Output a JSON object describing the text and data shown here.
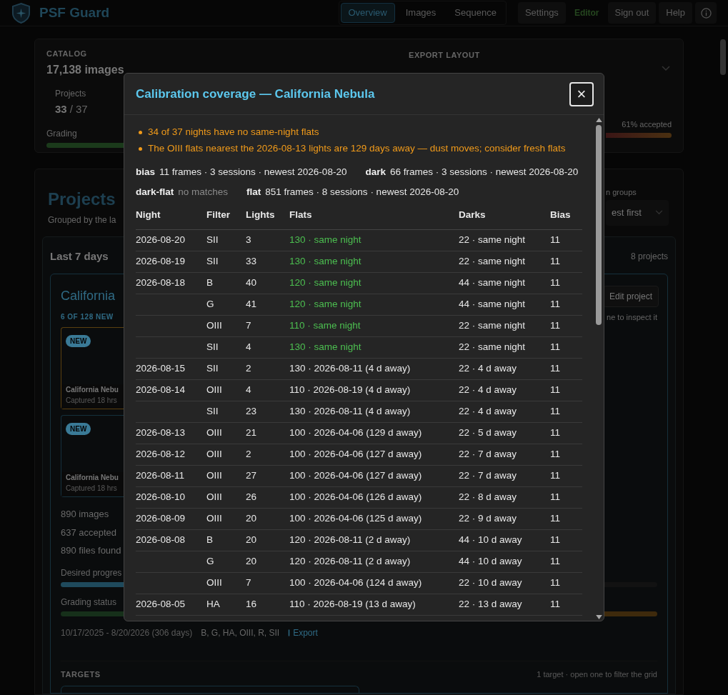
{
  "app": {
    "name": "PSF Guard"
  },
  "nav": {
    "tabs": [
      {
        "label": "Overview",
        "selected": true
      },
      {
        "label": "Images",
        "selected": false
      },
      {
        "label": "Sequence",
        "selected": false
      }
    ],
    "buttons": [
      {
        "kind": "button",
        "label": "Settings"
      },
      {
        "kind": "role",
        "label": "Editor"
      },
      {
        "kind": "button",
        "label": "Sign out"
      },
      {
        "kind": "button",
        "label": "Help"
      },
      {
        "kind": "info"
      }
    ]
  },
  "catalog": {
    "heading": "CATALOG",
    "count": "17,138 images",
    "stat_label": "Projects",
    "stat_value": "33",
    "stat_total": "/ 37",
    "grading_label": "Grading",
    "export_layout_label": "EXPORT LAYOUT",
    "accepted": "61% accepted"
  },
  "projects": {
    "title": "Projects",
    "subtitle": "Grouped by the la",
    "groups_label": "n groups",
    "sort": "est first",
    "group": {
      "title": "Last 7 days",
      "count": "8 projects",
      "project": {
        "name": "California",
        "edit": "Edit project",
        "new_heading": "6 OF 128 NEW",
        "hint": "ne to inspect it",
        "thumbs": [
          {
            "badge": "NEW",
            "title": "California Nebu",
            "caption": "Captured 18 hrs",
            "highlighted": true
          },
          {
            "badge": "NEW",
            "title": "California Nebu",
            "caption": "Captured 18 hrs",
            "highlighted": false
          }
        ],
        "stats": [
          "890 images",
          "637 accepted",
          "890 files found"
        ],
        "progress_label": "Desired progres",
        "progress": {
          "level": 0.14
        },
        "grading_label": "Grading status",
        "date_range": "10/17/2025 - 8/20/2026 (306 days)",
        "filters": "B, G, HA, OIII, R, SII",
        "export": "Export",
        "targets_heading": "TARGETS",
        "targets_hint": "1 target · open one to filter the grid"
      }
    }
  },
  "modal": {
    "title": "Calibration coverage — California Nebula",
    "close": "×",
    "warnings": [
      "34 of 37 nights have no same-night flats",
      "The OIII flats nearest the 2026-08-13 lights are 129 days away — dust moves; consider fresh flats"
    ],
    "summary": [
      {
        "label": "bias",
        "text": "11 frames · 3 sessions · newest 2026-08-20",
        "matched": true
      },
      {
        "label": "dark",
        "text": "66 frames · 3 sessions · newest 2026-08-20",
        "matched": true
      },
      {
        "label": "dark-flat",
        "text": "no matches",
        "matched": false
      },
      {
        "label": "flat",
        "text": "851 frames · 8 sessions · newest 2026-08-20",
        "matched": true
      }
    ],
    "table": {
      "columns": [
        "Night",
        "Filter",
        "Lights",
        "Flats",
        "Darks",
        "Bias"
      ],
      "rows": [
        {
          "night": "2026-08-20",
          "filter": "SII",
          "lights": "3",
          "flats": "130 · same night",
          "flats_same_night": true,
          "darks": "22 · same night",
          "bias": "11"
        },
        {
          "night": "2026-08-19",
          "filter": "SII",
          "lights": "33",
          "flats": "130 · same night",
          "flats_same_night": true,
          "darks": "22 · same night",
          "bias": "11"
        },
        {
          "night": "2026-08-18",
          "filter": "B",
          "lights": "40",
          "flats": "120 · same night",
          "flats_same_night": true,
          "darks": "44 · same night",
          "bias": "11"
        },
        {
          "filter": "G",
          "lights": "41",
          "flats": "120 · same night",
          "flats_same_night": true,
          "darks": "44 · same night",
          "bias": "11"
        },
        {
          "filter": "OIII",
          "lights": "7",
          "flats": "110 · same night",
          "flats_same_night": true,
          "darks": "22 · same night",
          "bias": "11"
        },
        {
          "filter": "SII",
          "lights": "4",
          "flats": "130 · same night",
          "flats_same_night": true,
          "darks": "22 · same night",
          "bias": "11"
        },
        {
          "night": "2026-08-15",
          "filter": "SII",
          "lights": "2",
          "flats": "130 · 2026-08-11 (4 d away)",
          "flats_same_night": false,
          "darks": "22 · 4 d away",
          "bias": "11"
        },
        {
          "night": "2026-08-14",
          "filter": "OIII",
          "lights": "4",
          "flats": "110 · 2026-08-19 (4 d away)",
          "flats_same_night": false,
          "darks": "22 · 4 d away",
          "bias": "11"
        },
        {
          "filter": "SII",
          "lights": "23",
          "flats": "130 · 2026-08-11 (4 d away)",
          "flats_same_night": false,
          "darks": "22 · 4 d away",
          "bias": "11"
        },
        {
          "night": "2026-08-13",
          "filter": "OIII",
          "lights": "21",
          "flats": "100 · 2026-04-06 (129 d away)",
          "flats_same_night": false,
          "darks": "22 · 5 d away",
          "bias": "11"
        },
        {
          "night": "2026-08-12",
          "filter": "OIII",
          "lights": "2",
          "flats": "100 · 2026-04-06 (127 d away)",
          "flats_same_night": false,
          "darks": "22 · 7 d away",
          "bias": "11"
        },
        {
          "night": "2026-08-11",
          "filter": "OIII",
          "lights": "27",
          "flats": "100 · 2026-04-06 (127 d away)",
          "flats_same_night": false,
          "darks": "22 · 7 d away",
          "bias": "11"
        },
        {
          "night": "2026-08-10",
          "filter": "OIII",
          "lights": "26",
          "flats": "100 · 2026-04-06 (126 d away)",
          "flats_same_night": false,
          "darks": "22 · 8 d away",
          "bias": "11"
        },
        {
          "night": "2026-08-09",
          "filter": "OIII",
          "lights": "20",
          "flats": "100 · 2026-04-06 (125 d away)",
          "flats_same_night": false,
          "darks": "22 · 9 d away",
          "bias": "11"
        },
        {
          "night": "2026-08-08",
          "filter": "B",
          "lights": "20",
          "flats": "120 · 2026-08-11 (2 d away)",
          "flats_same_night": false,
          "darks": "44 · 10 d away",
          "bias": "11"
        },
        {
          "filter": "G",
          "lights": "20",
          "flats": "120 · 2026-08-11 (2 d away)",
          "flats_same_night": false,
          "darks": "44 · 10 d away",
          "bias": "11"
        },
        {
          "filter": "OIII",
          "lights": "7",
          "flats": "100 · 2026-04-06 (124 d away)",
          "flats_same_night": false,
          "darks": "22 · 10 d away",
          "bias": "11"
        },
        {
          "night": "2026-08-05",
          "filter": "HA",
          "lights": "16",
          "flats": "110 · 2026-08-19 (13 d away)",
          "flats_same_night": false,
          "darks": "22 · 13 d away",
          "bias": "11"
        }
      ]
    }
  }
}
